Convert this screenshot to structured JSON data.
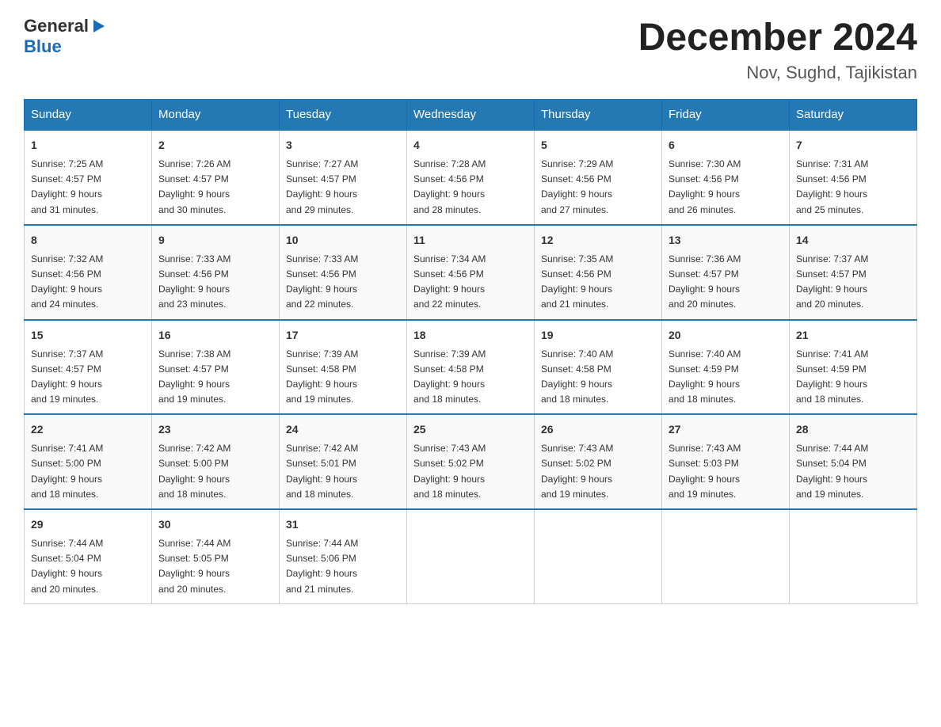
{
  "logo": {
    "line1": "General",
    "arrow": "▶",
    "line2": "Blue"
  },
  "title": "December 2024",
  "subtitle": "Nov, Sughd, Tajikistan",
  "days_of_week": [
    "Sunday",
    "Monday",
    "Tuesday",
    "Wednesday",
    "Thursday",
    "Friday",
    "Saturday"
  ],
  "weeks": [
    [
      {
        "day": "1",
        "sunrise": "7:25 AM",
        "sunset": "4:57 PM",
        "daylight": "9 hours and 31 minutes."
      },
      {
        "day": "2",
        "sunrise": "7:26 AM",
        "sunset": "4:57 PM",
        "daylight": "9 hours and 30 minutes."
      },
      {
        "day": "3",
        "sunrise": "7:27 AM",
        "sunset": "4:57 PM",
        "daylight": "9 hours and 29 minutes."
      },
      {
        "day": "4",
        "sunrise": "7:28 AM",
        "sunset": "4:56 PM",
        "daylight": "9 hours and 28 minutes."
      },
      {
        "day": "5",
        "sunrise": "7:29 AM",
        "sunset": "4:56 PM",
        "daylight": "9 hours and 27 minutes."
      },
      {
        "day": "6",
        "sunrise": "7:30 AM",
        "sunset": "4:56 PM",
        "daylight": "9 hours and 26 minutes."
      },
      {
        "day": "7",
        "sunrise": "7:31 AM",
        "sunset": "4:56 PM",
        "daylight": "9 hours and 25 minutes."
      }
    ],
    [
      {
        "day": "8",
        "sunrise": "7:32 AM",
        "sunset": "4:56 PM",
        "daylight": "9 hours and 24 minutes."
      },
      {
        "day": "9",
        "sunrise": "7:33 AM",
        "sunset": "4:56 PM",
        "daylight": "9 hours and 23 minutes."
      },
      {
        "day": "10",
        "sunrise": "7:33 AM",
        "sunset": "4:56 PM",
        "daylight": "9 hours and 22 minutes."
      },
      {
        "day": "11",
        "sunrise": "7:34 AM",
        "sunset": "4:56 PM",
        "daylight": "9 hours and 22 minutes."
      },
      {
        "day": "12",
        "sunrise": "7:35 AM",
        "sunset": "4:56 PM",
        "daylight": "9 hours and 21 minutes."
      },
      {
        "day": "13",
        "sunrise": "7:36 AM",
        "sunset": "4:57 PM",
        "daylight": "9 hours and 20 minutes."
      },
      {
        "day": "14",
        "sunrise": "7:37 AM",
        "sunset": "4:57 PM",
        "daylight": "9 hours and 20 minutes."
      }
    ],
    [
      {
        "day": "15",
        "sunrise": "7:37 AM",
        "sunset": "4:57 PM",
        "daylight": "9 hours and 19 minutes."
      },
      {
        "day": "16",
        "sunrise": "7:38 AM",
        "sunset": "4:57 PM",
        "daylight": "9 hours and 19 minutes."
      },
      {
        "day": "17",
        "sunrise": "7:39 AM",
        "sunset": "4:58 PM",
        "daylight": "9 hours and 19 minutes."
      },
      {
        "day": "18",
        "sunrise": "7:39 AM",
        "sunset": "4:58 PM",
        "daylight": "9 hours and 18 minutes."
      },
      {
        "day": "19",
        "sunrise": "7:40 AM",
        "sunset": "4:58 PM",
        "daylight": "9 hours and 18 minutes."
      },
      {
        "day": "20",
        "sunrise": "7:40 AM",
        "sunset": "4:59 PM",
        "daylight": "9 hours and 18 minutes."
      },
      {
        "day": "21",
        "sunrise": "7:41 AM",
        "sunset": "4:59 PM",
        "daylight": "9 hours and 18 minutes."
      }
    ],
    [
      {
        "day": "22",
        "sunrise": "7:41 AM",
        "sunset": "5:00 PM",
        "daylight": "9 hours and 18 minutes."
      },
      {
        "day": "23",
        "sunrise": "7:42 AM",
        "sunset": "5:00 PM",
        "daylight": "9 hours and 18 minutes."
      },
      {
        "day": "24",
        "sunrise": "7:42 AM",
        "sunset": "5:01 PM",
        "daylight": "9 hours and 18 minutes."
      },
      {
        "day": "25",
        "sunrise": "7:43 AM",
        "sunset": "5:02 PM",
        "daylight": "9 hours and 18 minutes."
      },
      {
        "day": "26",
        "sunrise": "7:43 AM",
        "sunset": "5:02 PM",
        "daylight": "9 hours and 19 minutes."
      },
      {
        "day": "27",
        "sunrise": "7:43 AM",
        "sunset": "5:03 PM",
        "daylight": "9 hours and 19 minutes."
      },
      {
        "day": "28",
        "sunrise": "7:44 AM",
        "sunset": "5:04 PM",
        "daylight": "9 hours and 19 minutes."
      }
    ],
    [
      {
        "day": "29",
        "sunrise": "7:44 AM",
        "sunset": "5:04 PM",
        "daylight": "9 hours and 20 minutes."
      },
      {
        "day": "30",
        "sunrise": "7:44 AM",
        "sunset": "5:05 PM",
        "daylight": "9 hours and 20 minutes."
      },
      {
        "day": "31",
        "sunrise": "7:44 AM",
        "sunset": "5:06 PM",
        "daylight": "9 hours and 21 minutes."
      },
      null,
      null,
      null,
      null
    ]
  ]
}
